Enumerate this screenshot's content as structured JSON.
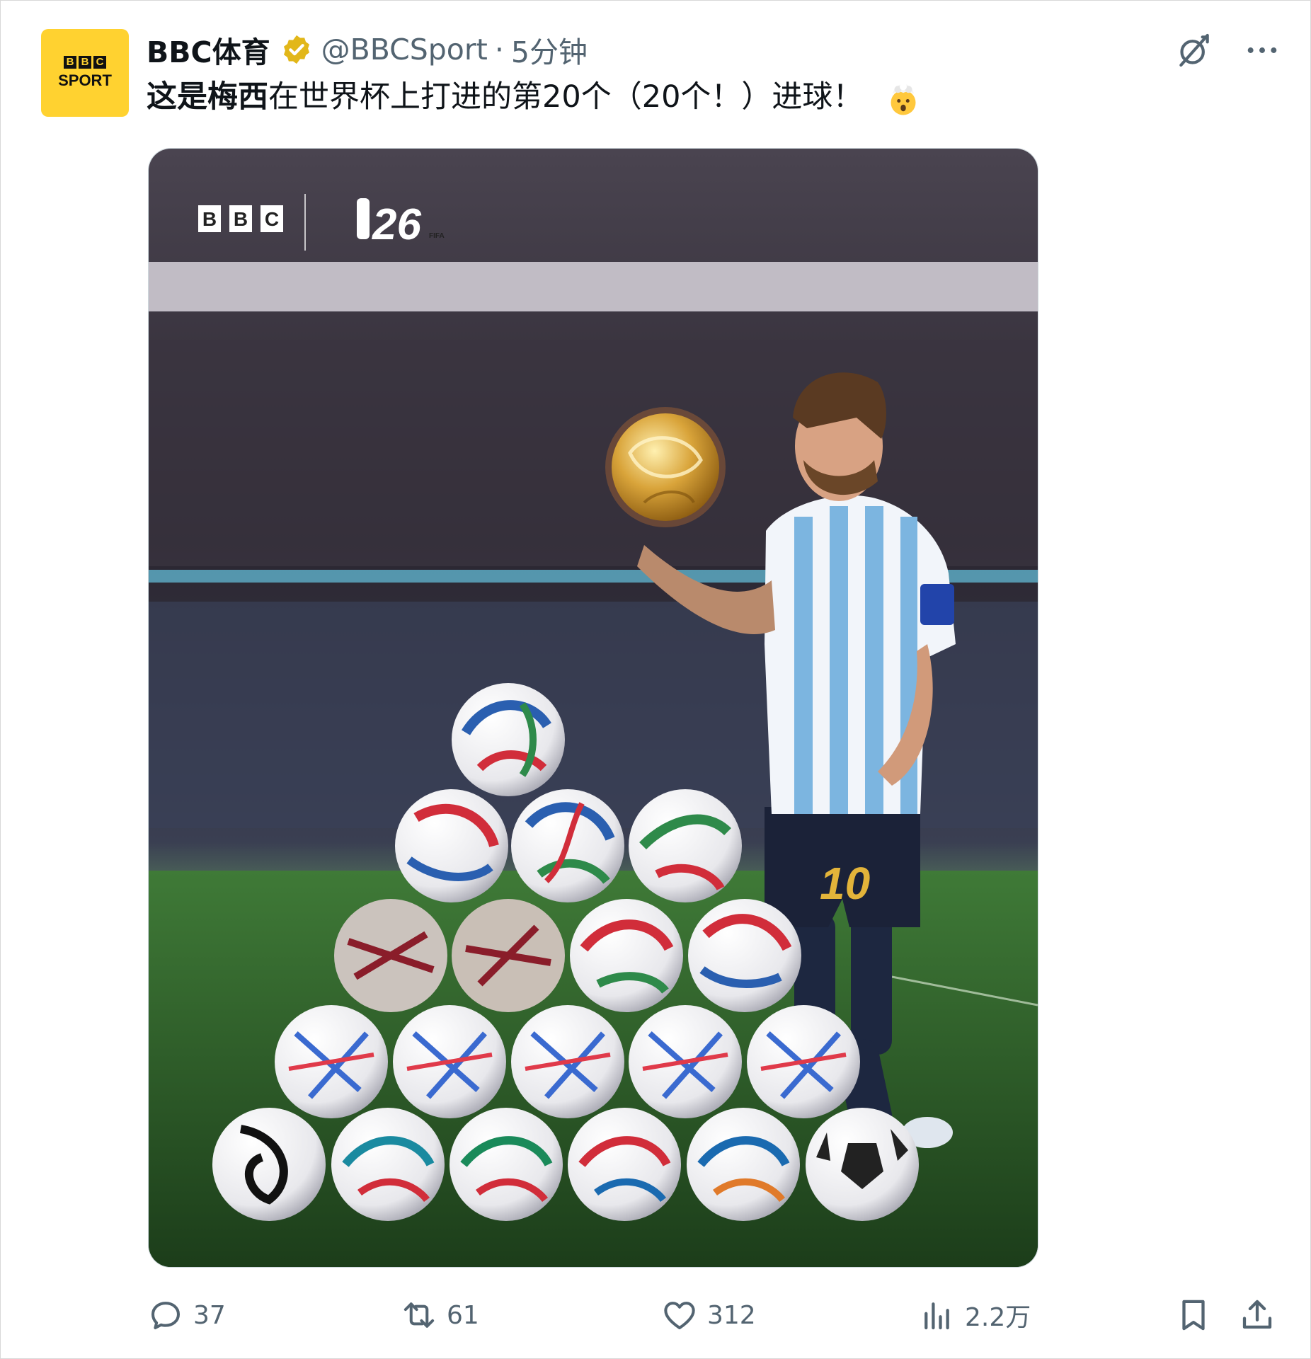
{
  "account": {
    "display_name": "BBC体育",
    "handle": "@BBCSport",
    "separator": "·",
    "time": "5分钟",
    "avatar_text": "SPORT",
    "avatar_letters": [
      "B",
      "B",
      "C"
    ]
  },
  "tweet": {
    "text_bold": "这是梅西",
    "text_rest": "在世界杯上打进的第20个（20个！）进球！",
    "emoji": "exploding-head-emoji"
  },
  "media": {
    "brand_letters": [
      "B",
      "B",
      "C"
    ],
    "event_logo_text": "26",
    "event_logo_sub": "FIFA",
    "shirt_number": "10"
  },
  "actions": {
    "replies": "37",
    "reposts": "61",
    "likes": "312",
    "views": "2.2万"
  },
  "colors": {
    "avatar_bg": "#ffd230",
    "verified_gold": "#e2b719",
    "muted_text": "#536471",
    "pitch_green": "#2f6a2a",
    "stadium_dark": "#2b2630"
  }
}
